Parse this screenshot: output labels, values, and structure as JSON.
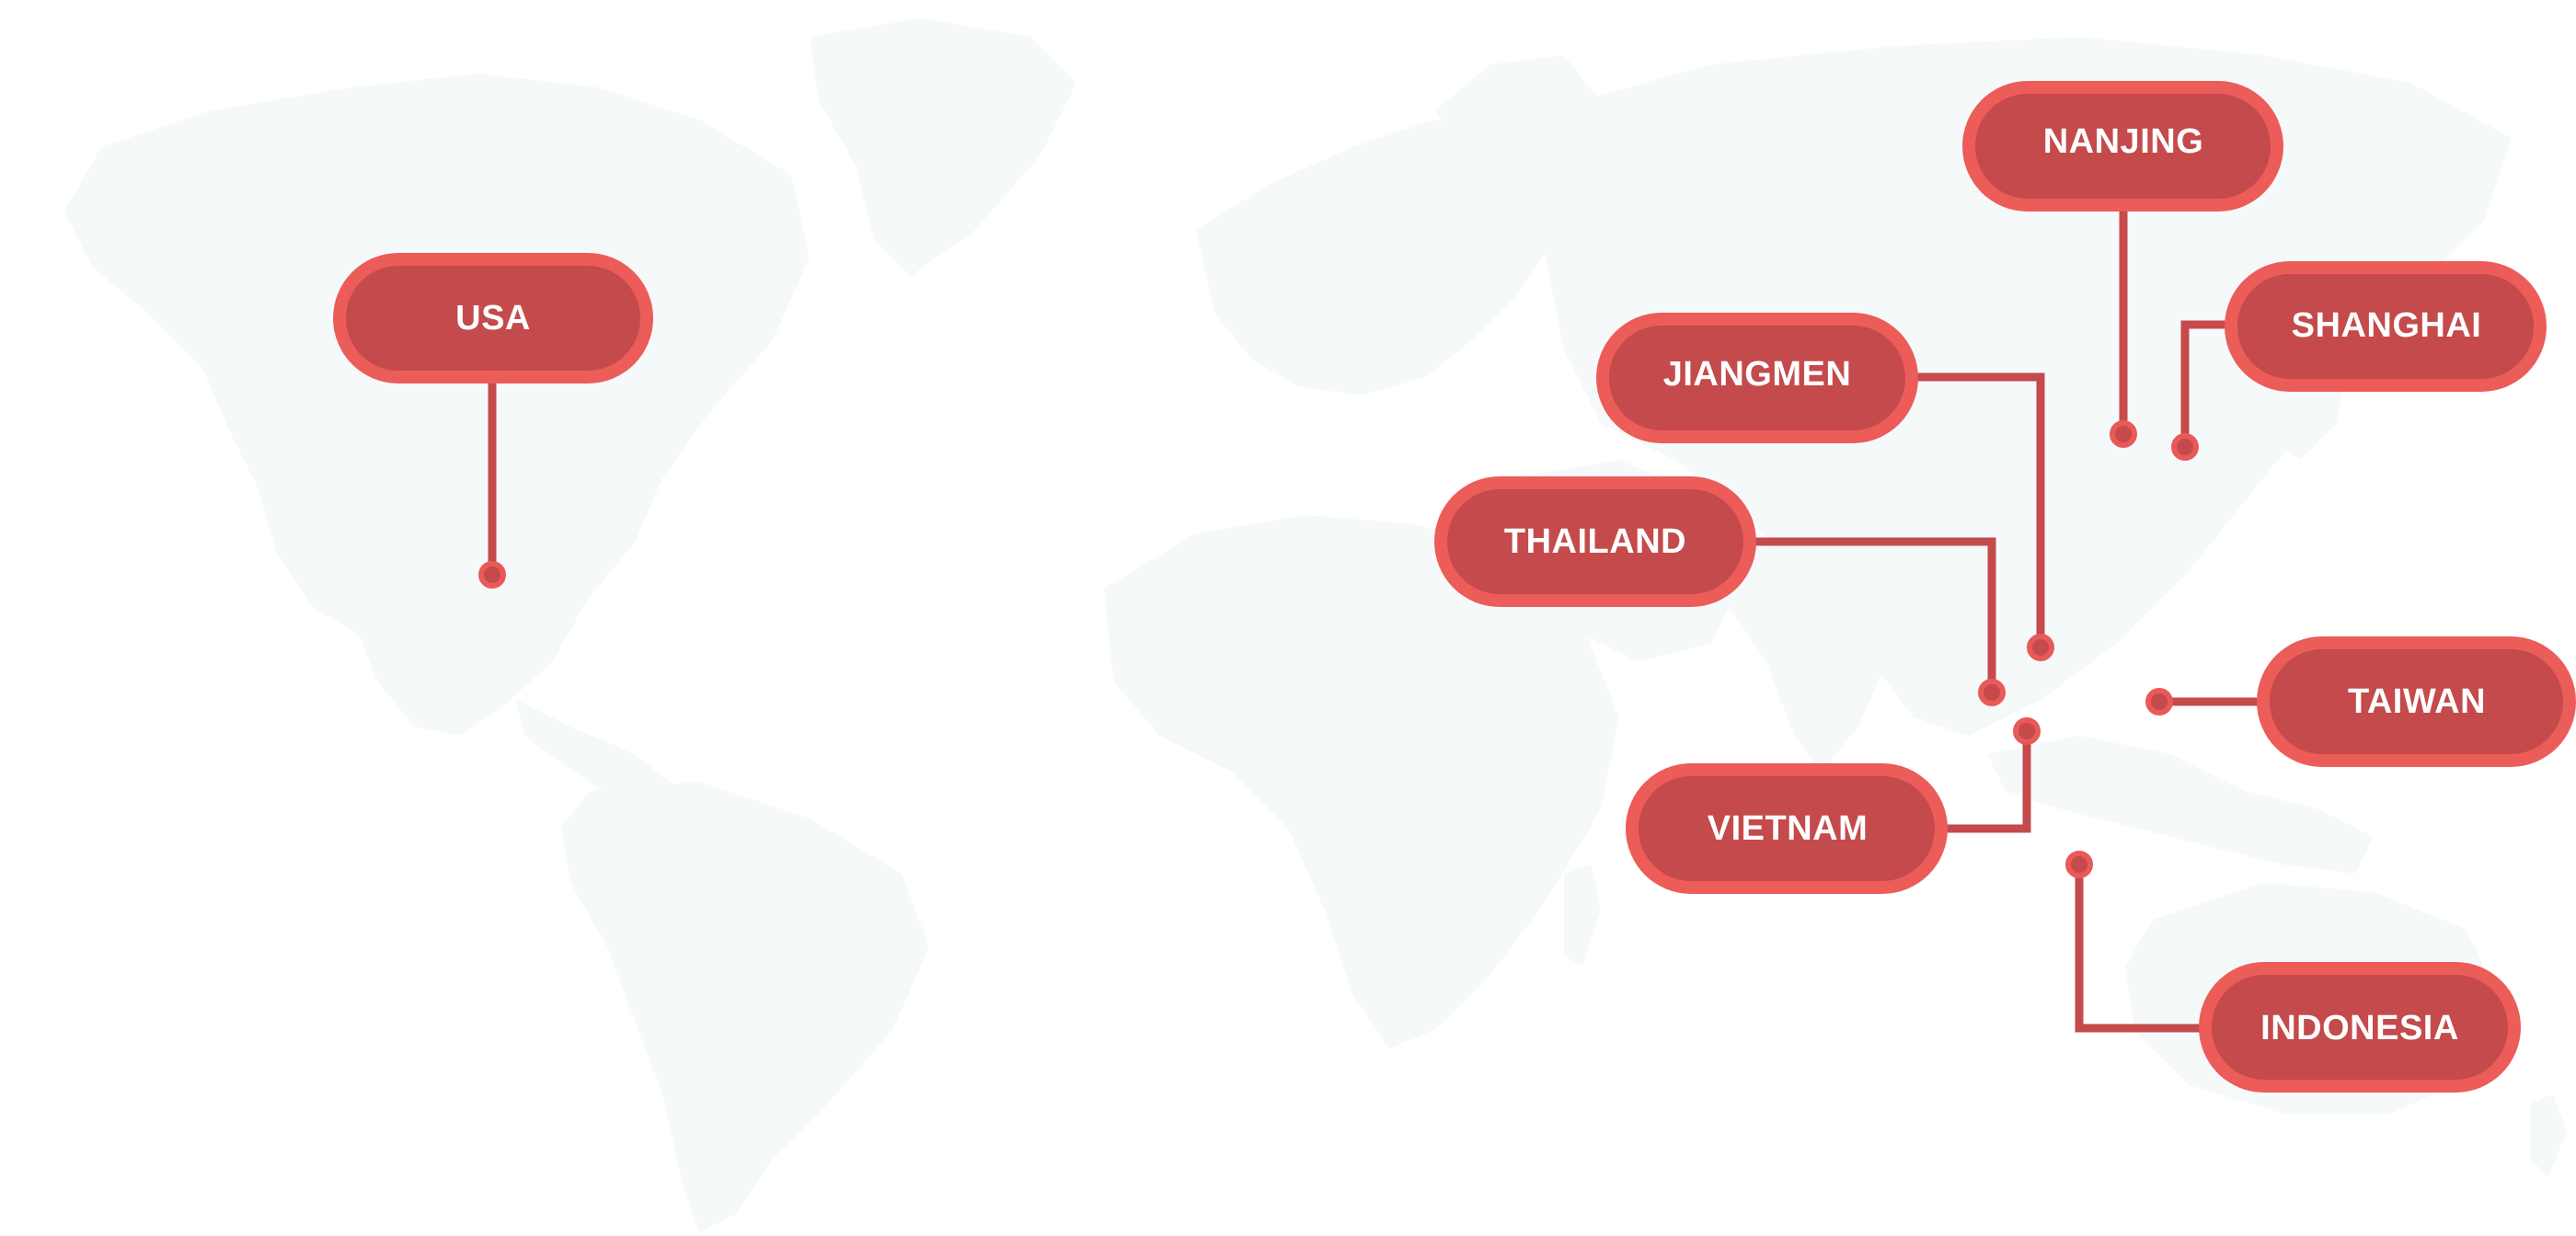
{
  "map": {
    "colors": {
      "land": "#f6f9fa",
      "connector": "#c44a4b",
      "pill_outer": "#ec5c59",
      "pill_inner": "#c44a4b",
      "label_text": "#ffffff"
    },
    "locations": [
      {
        "id": "usa",
        "label": "USA"
      },
      {
        "id": "nanjing",
        "label": "NANJING"
      },
      {
        "id": "shanghai",
        "label": "SHANGHAI"
      },
      {
        "id": "jiangmen",
        "label": "JIANGMEN"
      },
      {
        "id": "thailand",
        "label": "THAILAND"
      },
      {
        "id": "taiwan",
        "label": "TAIWAN"
      },
      {
        "id": "vietnam",
        "label": "VIETNAM"
      },
      {
        "id": "indonesia",
        "label": "INDONESIA"
      }
    ]
  }
}
